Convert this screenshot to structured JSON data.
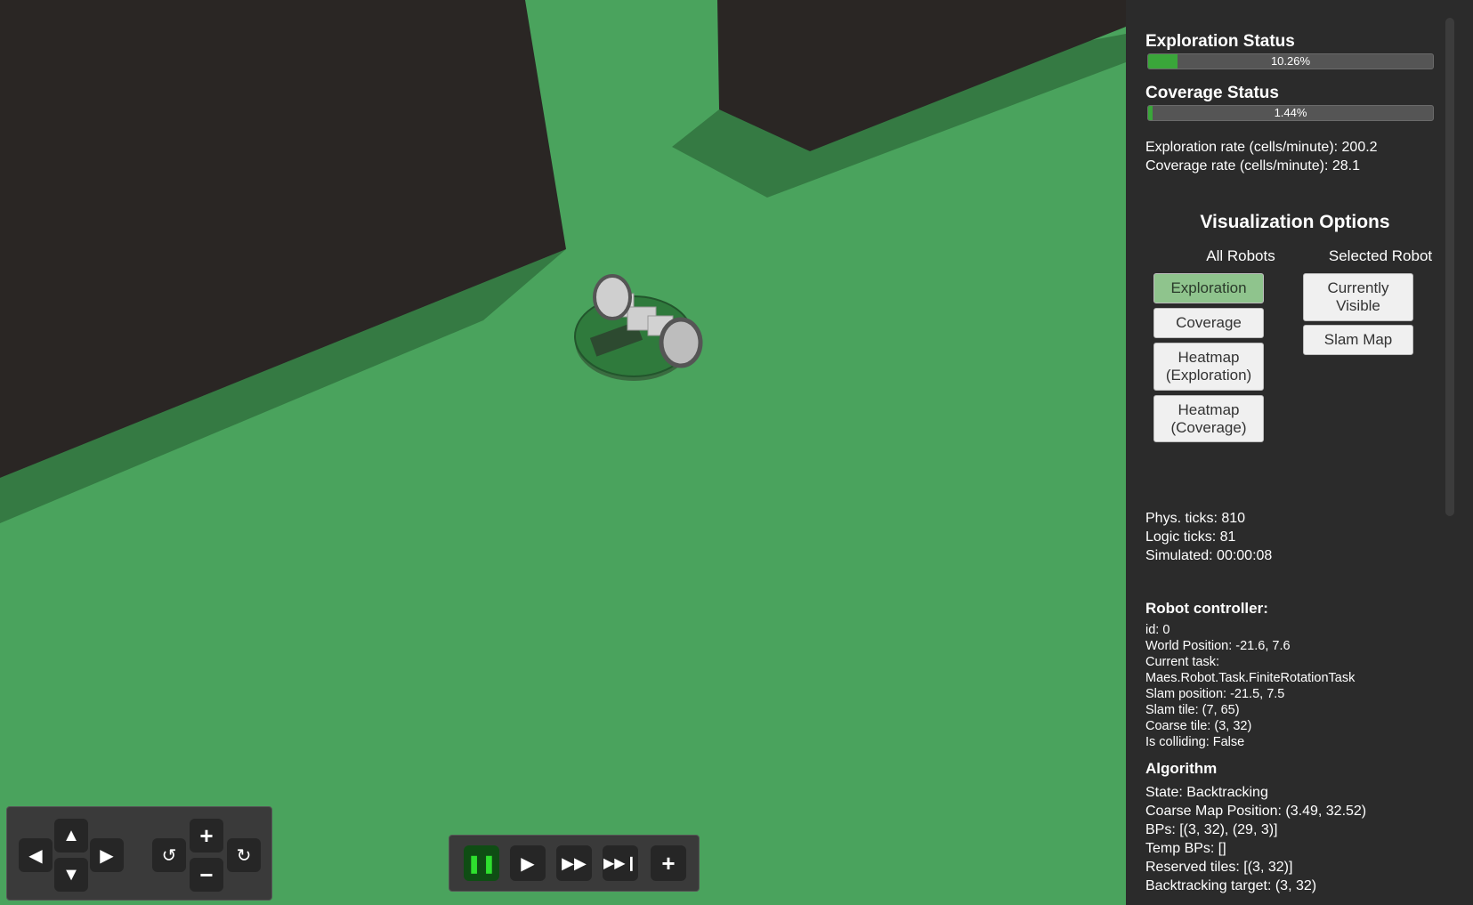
{
  "status": {
    "exploration_title": "Exploration Status",
    "exploration_progress": 10.26,
    "exploration_text": "10.26%",
    "coverage_title": "Coverage Status",
    "coverage_progress": 1.44,
    "coverage_text": "1.44%",
    "exploration_rate": "Exploration rate (cells/minute): 200.2",
    "coverage_rate": "Coverage rate (cells/minute): 28.1"
  },
  "visualization": {
    "title": "Visualization Options",
    "all_robots_label": "All Robots",
    "selected_robot_label": "Selected Robot",
    "all_buttons": [
      "Exploration",
      "Coverage",
      "Heatmap (Exploration)",
      "Heatmap (Coverage)"
    ],
    "selected_buttons": [
      "Currently Visible",
      "Slam Map"
    ],
    "active_button": "Exploration"
  },
  "ticks": {
    "phys": "Phys. ticks: 810",
    "logic": "Logic ticks: 81",
    "simulated": "Simulated: 00:00:08"
  },
  "controller": {
    "title": "Robot controller:",
    "lines": [
      "id: 0",
      "World Position: -21.6, 7.6",
      "Current task:",
      "Maes.Robot.Task.FiniteRotationTask",
      "Slam position: -21.5, 7.5",
      "Slam tile: (7, 65)",
      "Coarse tile: (3, 32)",
      "Is colliding: False"
    ]
  },
  "algorithm": {
    "title": "Algorithm",
    "lines": [
      "State: Backtracking",
      "Coarse Map Position: (3.49, 32.52)",
      "BPs: [(3, 32), (29, 3)]",
      "Temp BPs: []",
      "Reserved tiles: [(3, 32)]",
      "Backtracking target: (3, 32)"
    ]
  },
  "camera_controls": {
    "up_icon": "arrow-up-icon",
    "down_icon": "arrow-down-icon",
    "left_icon": "arrow-left-icon",
    "right_icon": "arrow-right-icon",
    "rotate_left_icon": "rotate-ccw-icon",
    "rotate_right_icon": "rotate-cw-icon",
    "zoom_in_icon": "plus-icon",
    "zoom_out_icon": "minus-icon"
  },
  "playback": {
    "buttons": [
      "pause-icon",
      "play-icon",
      "fast-forward-icon",
      "fastest-icon",
      "plus-icon"
    ],
    "active": "pause-icon"
  },
  "colors": {
    "floor": "#4aa35d",
    "wall": "#2a2624",
    "shadow": "#357a43",
    "panel": "#2b2b2b",
    "progress_fill": "#3aa63a",
    "active_button": "#8fc48d"
  }
}
